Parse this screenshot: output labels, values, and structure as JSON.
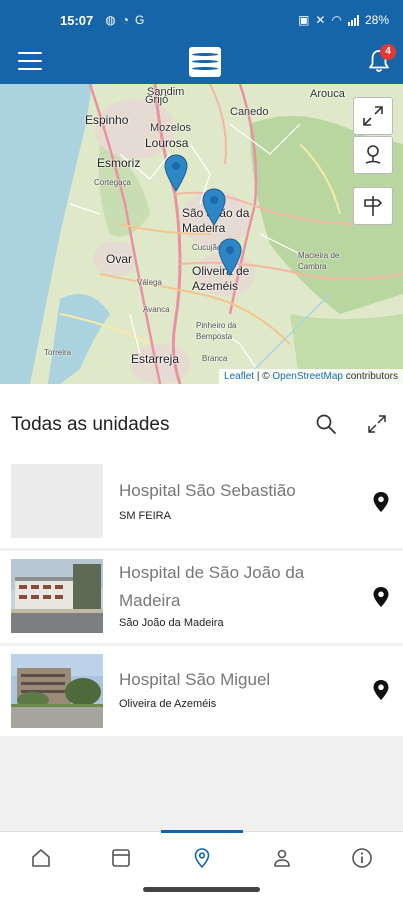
{
  "status_bar": {
    "time": "15:07",
    "left_icons": [
      "messenger-icon",
      "sync-icon",
      "google-icon"
    ],
    "battery": "28%",
    "right_icons": [
      "nfc-icon",
      "mute-icon",
      "wifi-icon",
      "signal-icon"
    ]
  },
  "app_bar": {
    "menu_icon": "hamburger-icon",
    "logo_icon": "brand-logo-icon",
    "notifications_count": "4",
    "accent_color": "#1565a8"
  },
  "map": {
    "labels": {
      "espinho": "Espinho",
      "lourosa": "Lourosa",
      "mozelos": "Mozelos",
      "esmoriz": "Esmoriz",
      "cortegaca": "Cortegaça",
      "sao_joao": "São João da Madeira",
      "ovar": "Ovar",
      "oliveira": "Oliveira de Azeméis",
      "cucujaes": "Cucujães",
      "valega": "Válega",
      "avanca": "Avanca",
      "pinheiro": "Pinheiro da Bemposta",
      "macieira": "Macieira de Cambra",
      "estarreja": "Estarreja",
      "torreira": "Torreira",
      "branca": "Branca",
      "grijo": "Grijó",
      "sandim": "Sandim",
      "canedo": "Canedo",
      "arouca": "Arouca"
    },
    "attribution": {
      "leaflet": "Leaflet",
      "separator": " | © ",
      "osm": "OpenStreetMap",
      "contributors": " contributors"
    },
    "controls": [
      "fullscreen-icon",
      "locate-user-icon",
      "directions-sign-icon"
    ]
  },
  "section": {
    "title": "Todas as unidades"
  },
  "units": [
    {
      "name": "Hospital São Sebastião",
      "location": "SM FEIRA"
    },
    {
      "name": "Hospital de São João da Madeira",
      "location": "São João da Madeira"
    },
    {
      "name": "Hospital São Miguel",
      "location": "Oliveira de Azeméis"
    }
  ],
  "bottom_nav": {
    "items": [
      "home-icon",
      "calendar-icon",
      "map-pin-icon",
      "profile-icon",
      "info-icon"
    ],
    "active": "map-pin-icon"
  }
}
